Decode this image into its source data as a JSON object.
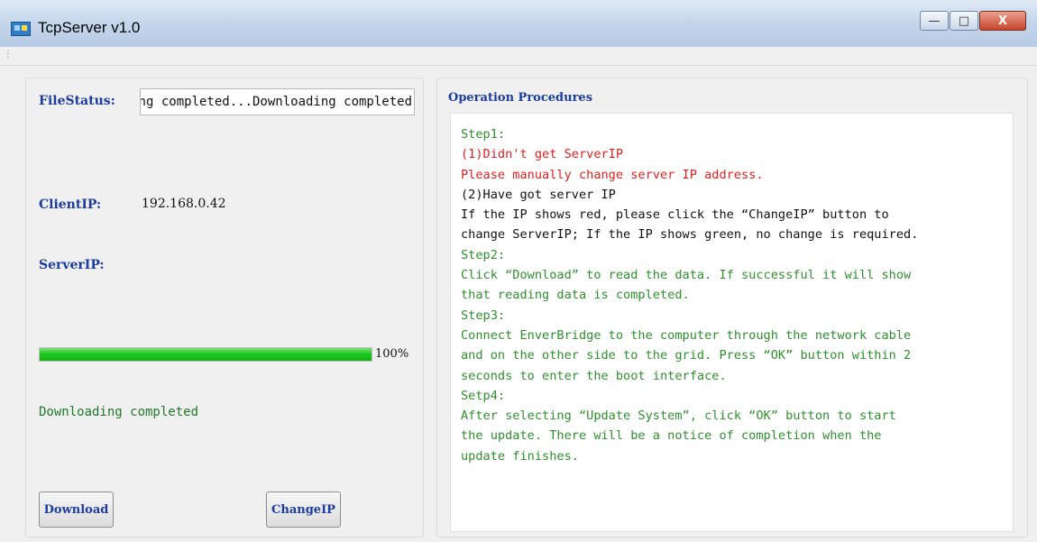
{
  "window": {
    "title": "TcpServer v1.0"
  },
  "caption_buttons": {
    "minimize": "—",
    "maximize": "□",
    "close": "X"
  },
  "left": {
    "filestatus_label": "FileStatus:",
    "filestatus_value": "Downloading completed...Downloading completed",
    "clientip_label": "ClientIP:",
    "clientip_value": "192.168.0.42",
    "serverip_label": "ServerIP:",
    "serverip_value": "",
    "progress_percent": 100,
    "progress_text": "100%",
    "status_text": "Downloading completed",
    "download_button": "Download",
    "changeip_button": "ChangeIP"
  },
  "right": {
    "title": "Operation Procedures",
    "lines": [
      {
        "text": "Step1:",
        "color": "green"
      },
      {
        "text": "(1)Didn't get ServerIP",
        "color": "red"
      },
      {
        "text": "Please manually change server IP address.",
        "color": "red"
      },
      {
        "text": "(2)Have got server IP",
        "color": "black"
      },
      {
        "text": "If the IP shows red, please click the “ChangeIP” button to",
        "color": "black"
      },
      {
        "text": "change ServerIP; If the IP shows green, no change is required.",
        "color": "black"
      },
      {
        "text": "Step2:",
        "color": "green"
      },
      {
        "text": "Click “Download” to read the data. If successful it will show",
        "color": "green"
      },
      {
        "text": "that reading data is completed.",
        "color": "green"
      },
      {
        "text": "Step3:",
        "color": "green"
      },
      {
        "text": "Connect EnverBridge to the computer through the network cable",
        "color": "green"
      },
      {
        "text": "and on the other side to the grid. Press “OK” button within 2",
        "color": "green"
      },
      {
        "text": "seconds to enter the boot interface.",
        "color": "green"
      },
      {
        "text": "Setp4:",
        "color": "green"
      },
      {
        "text": "After selecting “Update System”, click “OK” button to start",
        "color": "green"
      },
      {
        "text": "the update. There will be a notice of completion when the",
        "color": "green"
      },
      {
        "text": "update finishes.",
        "color": "green"
      }
    ]
  }
}
